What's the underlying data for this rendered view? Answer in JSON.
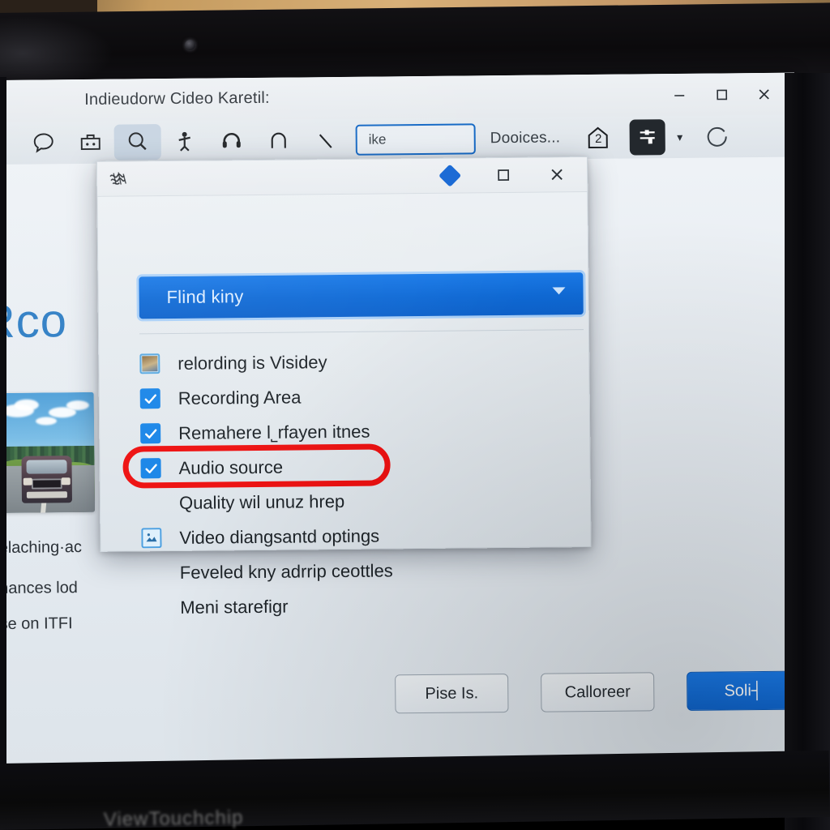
{
  "scene": {
    "device_brand_text": "ViewTouchchip"
  },
  "window": {
    "title": "Indieudorw Cideo Karetil:",
    "controls": [
      {
        "name": "minimize",
        "glyph": "–"
      },
      {
        "name": "maximize",
        "glyph": "□"
      },
      {
        "name": "close",
        "glyph": "✕"
      }
    ]
  },
  "toolbar": {
    "icons": [
      {
        "name": "speech-bubble-icon"
      },
      {
        "name": "toolbox-icon"
      },
      {
        "name": "search-icon",
        "active": true
      },
      {
        "name": "person-icon"
      },
      {
        "name": "headphones-icon"
      },
      {
        "name": "arch-icon"
      },
      {
        "name": "line-icon"
      }
    ],
    "field_value": "ike",
    "menu_label": "Dooices...",
    "home_badge": "2",
    "dark_button": "sliders-icon",
    "caret": "▾",
    "refresh": "refresh-icon"
  },
  "page": {
    "headline": "Rco",
    "lines": [
      "еelaching·ac",
      "anances lod",
      "use on ІTFI"
    ]
  },
  "dialog": {
    "icon_name": "scribble-icon",
    "controls": [
      {
        "name": "pin-button",
        "glyph": ""
      },
      {
        "name": "maximize-button",
        "glyph": "□"
      },
      {
        "name": "close-button",
        "glyph": "✕"
      }
    ],
    "dropdown": {
      "value": "Flind kiny",
      "caret": "▾"
    },
    "options": [
      {
        "label": "relording is Visidey",
        "type": "image",
        "checked": false
      },
      {
        "label": "Recording Area",
        "type": "checkbox",
        "checked": true
      },
      {
        "label": "Remahere l˾rfayen itnes",
        "type": "checkbox",
        "checked": true
      },
      {
        "label": "Audio source",
        "type": "checkbox",
        "checked": true,
        "highlighted": true
      },
      {
        "label": "Quality wil unuz hrep",
        "type": "plain",
        "checked": false
      },
      {
        "label": "Video diangsantd optings",
        "type": "image2",
        "checked": false
      },
      {
        "label": "Feveled kny adrrip ceottles",
        "type": "plain",
        "checked": false
      },
      {
        "label": "Meni starefigr",
        "type": "plain",
        "checked": false
      }
    ],
    "highlight_color": "#ee1111"
  },
  "footer": {
    "buttons": [
      {
        "label": "Pise Is.",
        "primary": false
      },
      {
        "label": "Calloreer",
        "primary": false
      },
      {
        "label": "Soli┤",
        "primary": true
      }
    ]
  },
  "colors": {
    "accent_blue": "#1a7ae8",
    "highlight_red": "#ee1111",
    "headline_blue": "#2d7dc4"
  }
}
